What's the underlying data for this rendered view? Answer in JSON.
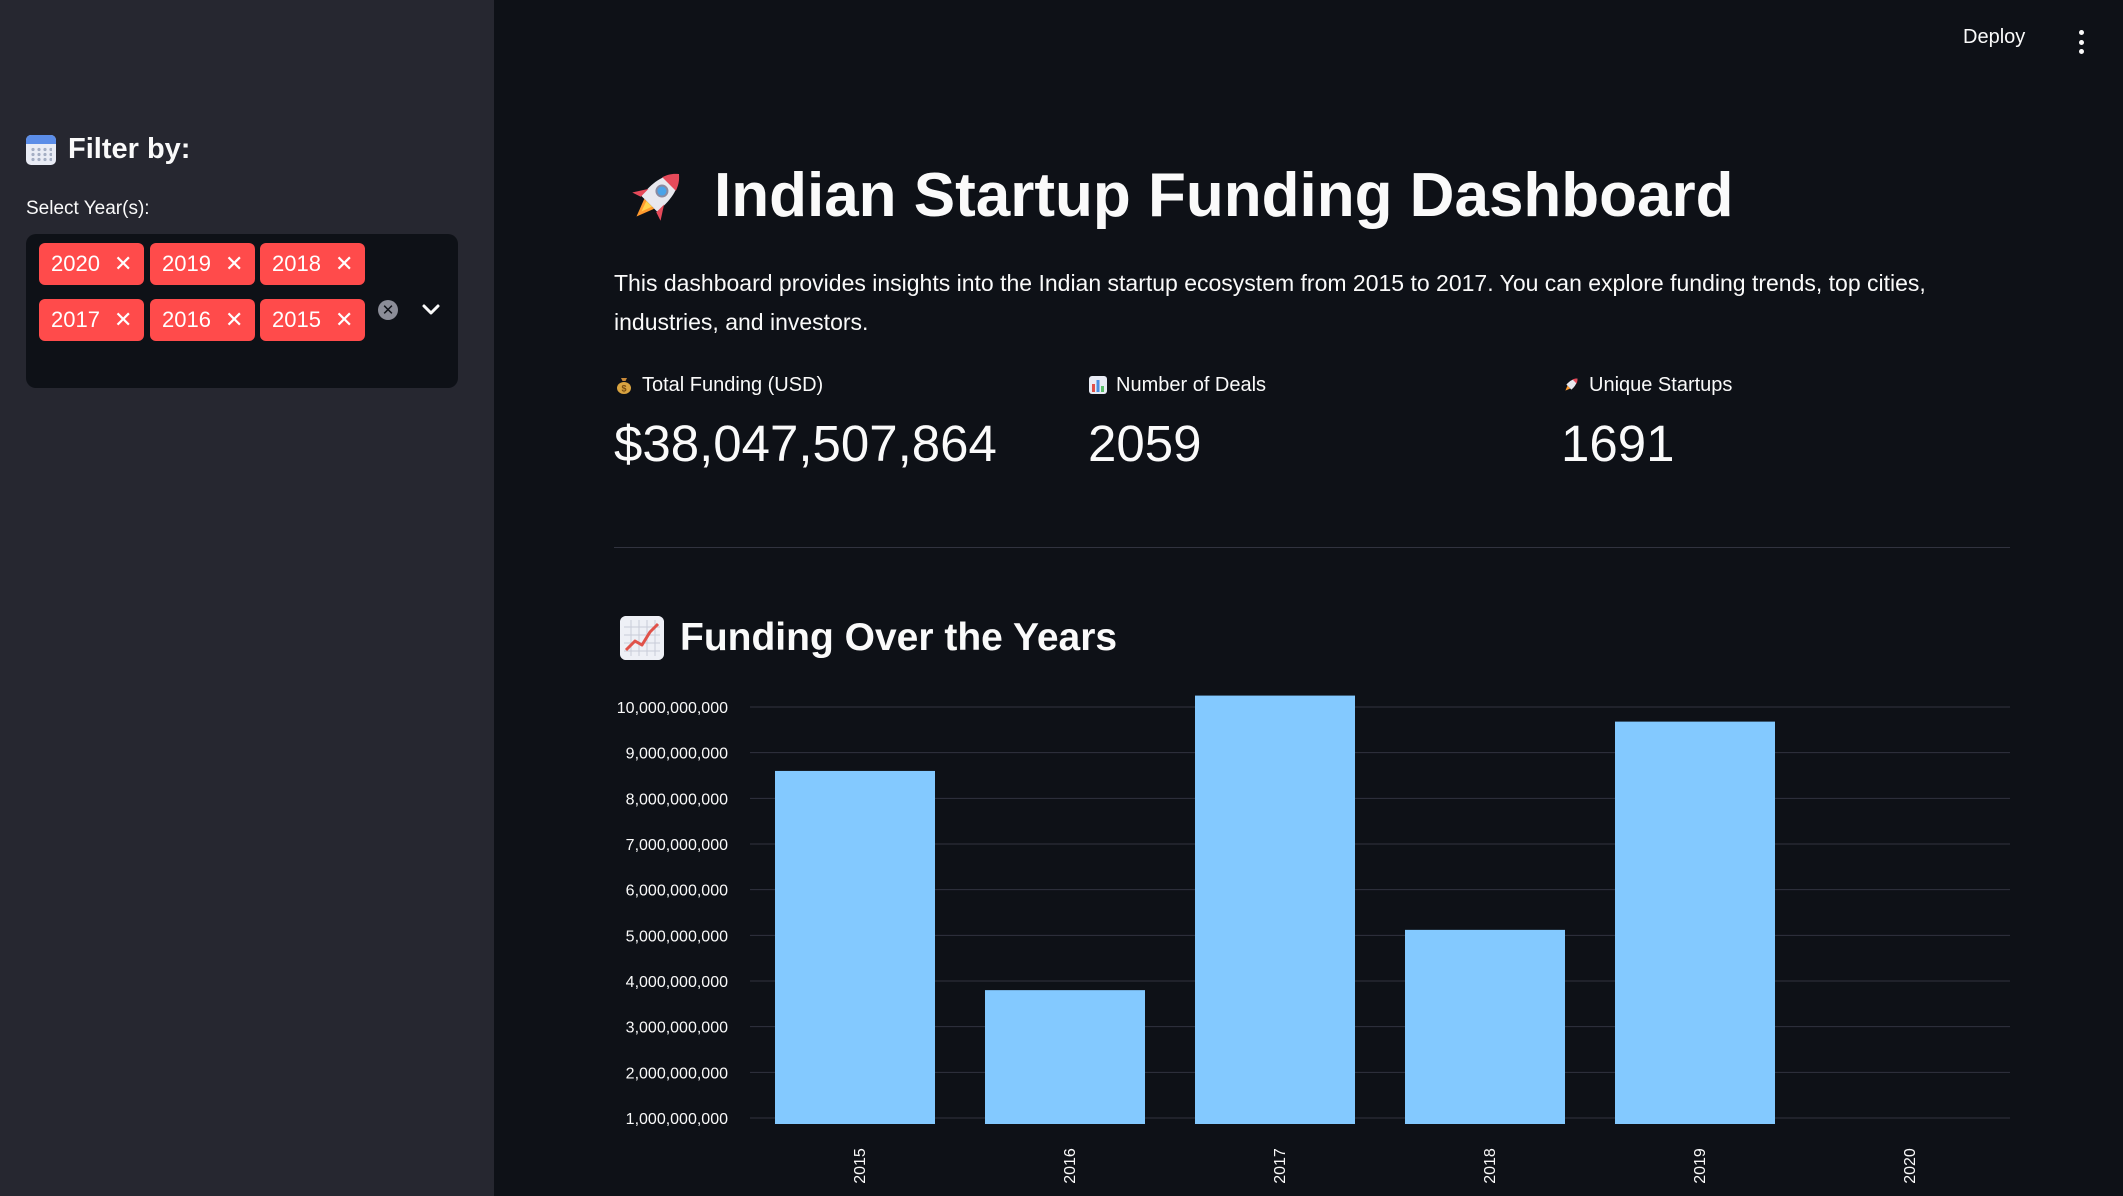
{
  "sidebar": {
    "heading": "Filter by:",
    "heading_icon": "calendar-icon",
    "select_label": "Select Year(s):",
    "selected_years": [
      "2020",
      "2019",
      "2018",
      "2017",
      "2016",
      "2015"
    ],
    "tag_color": "#ff4b4b"
  },
  "header": {
    "deploy_label": "Deploy",
    "menu_icon": "kebab-menu-icon"
  },
  "main": {
    "title": "Indian Startup Funding Dashboard",
    "title_icon": "rocket-icon",
    "description": "This dashboard provides insights into the Indian startup ecosystem from 2015 to 2017. You can explore funding trends, top cities, industries, and investors.",
    "metrics": [
      {
        "icon": "money-bag-icon",
        "label": "Total Funding (USD)",
        "value": "$38,047,507,864"
      },
      {
        "icon": "bar-chart-icon",
        "label": "Number of Deals",
        "value": "2059"
      },
      {
        "icon": "rocket-icon",
        "label": "Unique Startups",
        "value": "1691"
      }
    ],
    "section_title": "Funding Over the Years",
    "section_icon": "chart-increasing-icon"
  },
  "chart_data": {
    "type": "bar",
    "categories": [
      "2015",
      "2016",
      "2017",
      "2018",
      "2019",
      "2020"
    ],
    "values": [
      8600000000,
      3800000000,
      10250000000,
      5120000000,
      9680000000,
      0
    ],
    "yticks": [
      "1,000,000,000",
      "2,000,000,000",
      "3,000,000,000",
      "4,000,000,000",
      "5,000,000,000",
      "6,000,000,000",
      "7,000,000,000",
      "8,000,000,000",
      "9,000,000,000",
      "10,000,000,000"
    ],
    "ylim": [
      800000000,
      10300000000
    ],
    "grid": true,
    "bar_color": "#83c9ff"
  }
}
